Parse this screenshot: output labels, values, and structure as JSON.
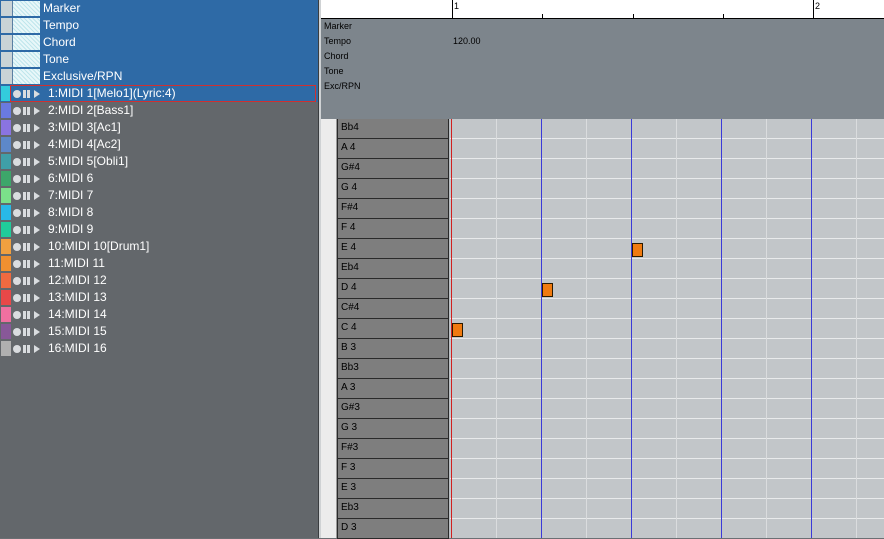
{
  "special_tracks": [
    {
      "label": "Marker"
    },
    {
      "label": "Tempo"
    },
    {
      "label": "Chord"
    },
    {
      "label": "Tone"
    },
    {
      "label": "Exclusive/RPN"
    }
  ],
  "tracks": [
    {
      "label": "1:MIDI 1[Melo1](Lyric:4)",
      "color": "#33ccdd",
      "selected": true
    },
    {
      "label": "2:MIDI 2[Bass1]",
      "color": "#6a7ae0"
    },
    {
      "label": "3:MIDI 3[Ac1]",
      "color": "#8a74e0"
    },
    {
      "label": "4:MIDI 4[Ac2]",
      "color": "#5d88c9"
    },
    {
      "label": "5:MIDI 5[Obli1]",
      "color": "#3f9fa8"
    },
    {
      "label": "6:MIDI 6",
      "color": "#3da66a"
    },
    {
      "label": "7:MIDI 7",
      "color": "#7be08a"
    },
    {
      "label": "8:MIDI 8",
      "color": "#28b8e8"
    },
    {
      "label": "9:MIDI 9",
      "color": "#20cc9a"
    },
    {
      "label": "10:MIDI 10[Drum1]",
      "color": "#f0a040"
    },
    {
      "label": "11:MIDI 11",
      "color": "#f09030"
    },
    {
      "label": "12:MIDI 12",
      "color": "#f06a40"
    },
    {
      "label": "13:MIDI 13",
      "color": "#e84848"
    },
    {
      "label": "14:MIDI 14",
      "color": "#f070a0"
    },
    {
      "label": "15:MIDI 15",
      "color": "#885898"
    },
    {
      "label": "16:MIDI 16",
      "color": "#b0b0b0"
    }
  ],
  "conductor": {
    "marker_label": "Marker",
    "tempo_label": "Tempo",
    "chord_label": "Chord",
    "tone_label": "Tone",
    "exc_label": "Exc/RPN",
    "tempo_value": "120.00"
  },
  "ruler": {
    "measures": [
      "1",
      "2"
    ]
  },
  "keys": [
    "Bb4",
    "A 4",
    "G#4",
    "G 4",
    "F#4",
    "F 4",
    "E 4",
    "Eb4",
    "D 4",
    "C#4",
    "C 4",
    "B 3",
    "Bb3",
    "A 3",
    "G#3",
    "G 3",
    "F#3",
    "F 3",
    "E 3",
    "Eb3",
    "D 3"
  ],
  "notes": [
    {
      "pitch": "C 4",
      "beat": 1
    },
    {
      "pitch": "D 4",
      "beat": 2
    },
    {
      "pitch": "E 4",
      "beat": 3
    }
  ]
}
